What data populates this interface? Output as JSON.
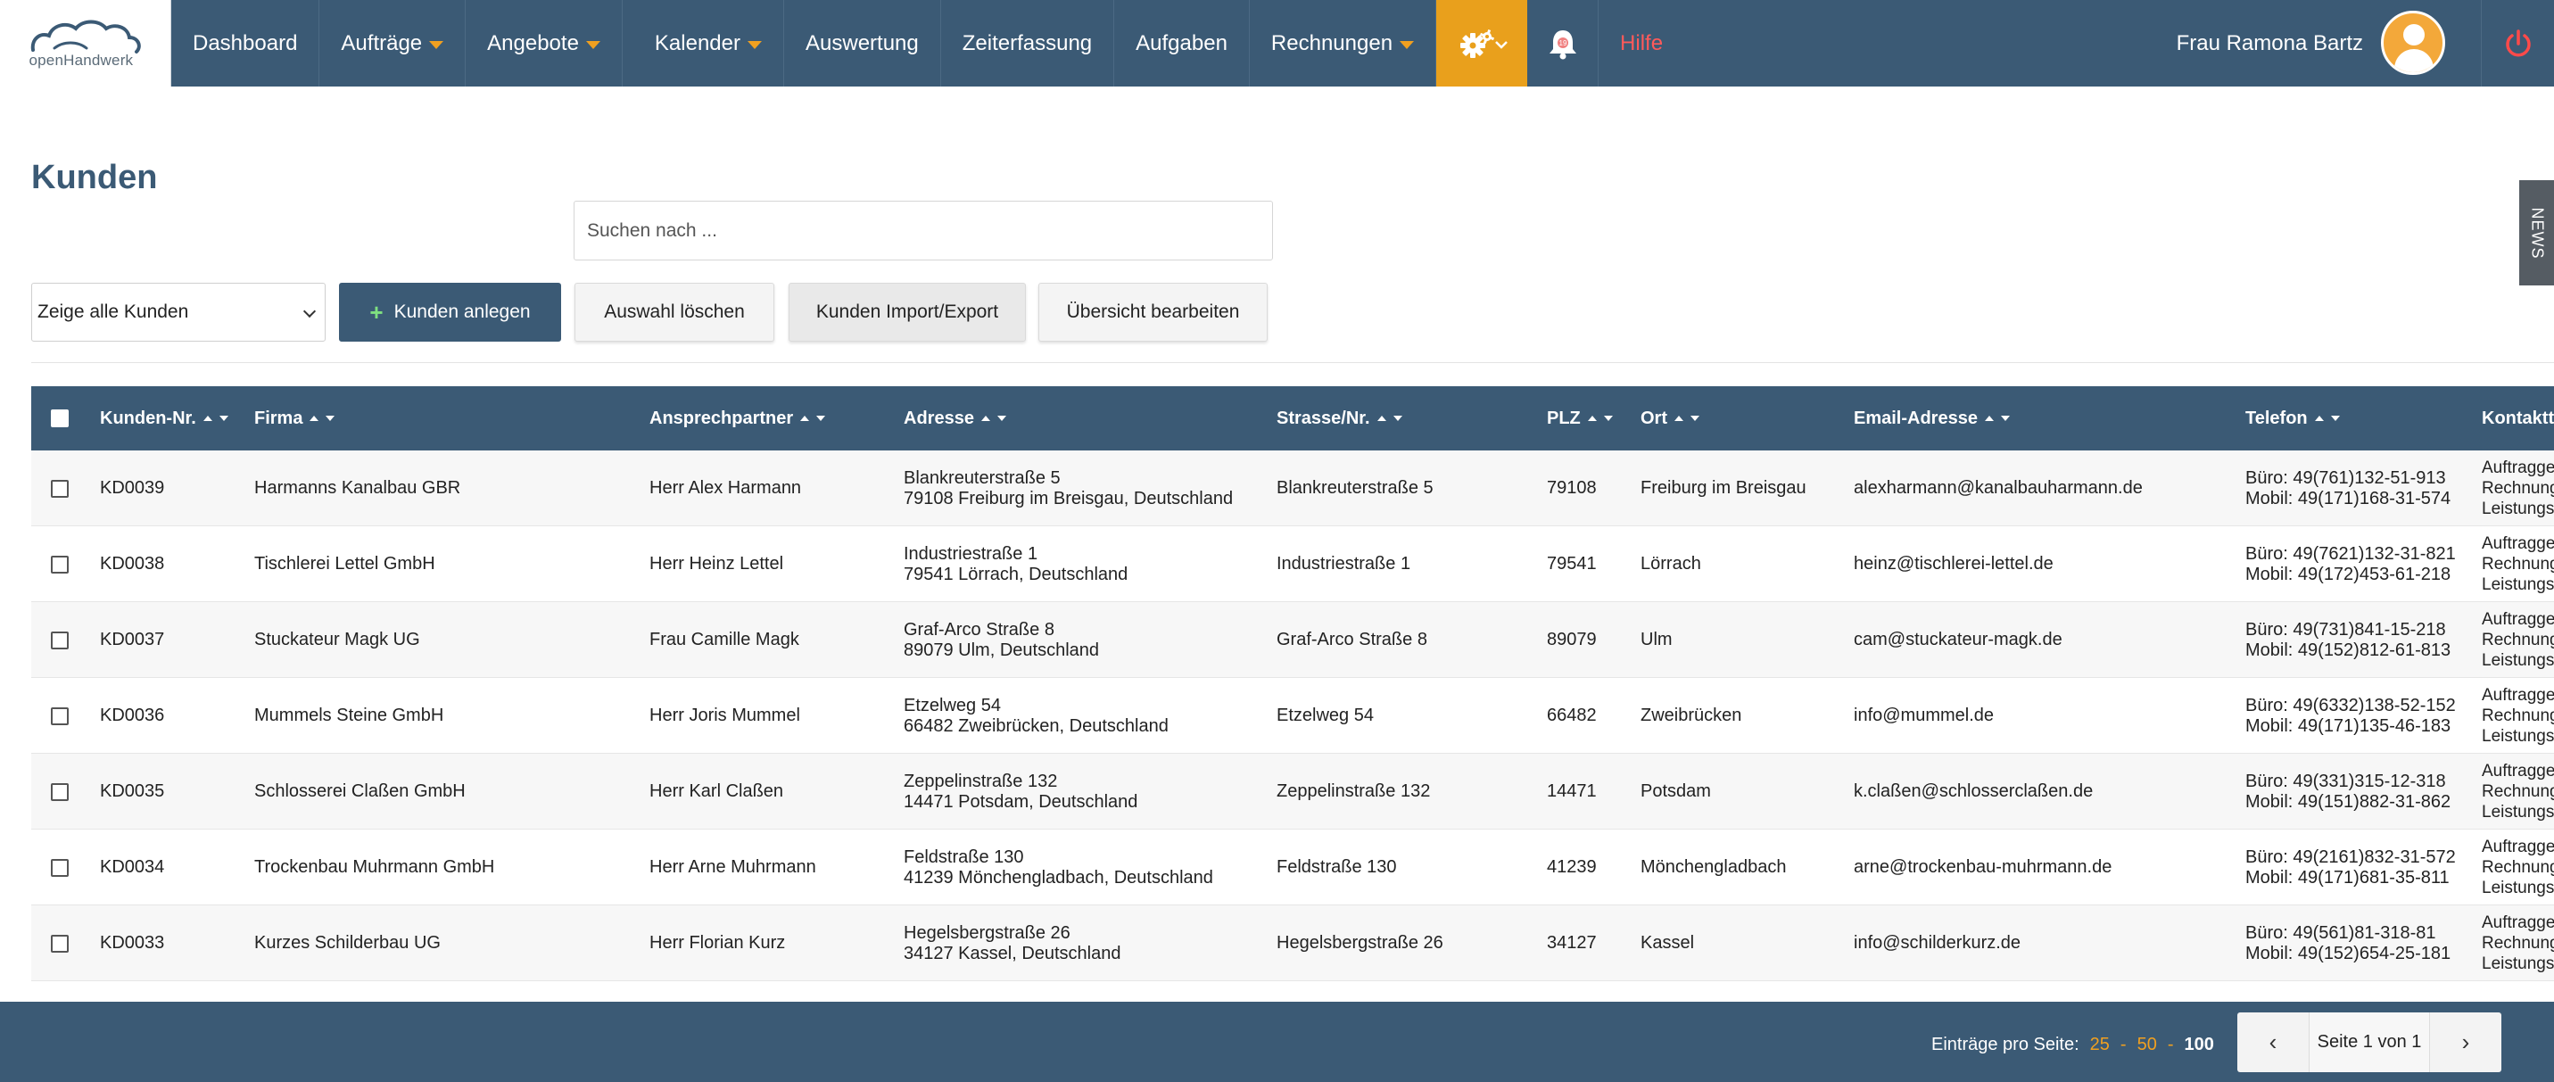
{
  "nav": {
    "logo_text": "openHandwerk",
    "items": [
      {
        "label": "Dashboard",
        "caret": false
      },
      {
        "label": "Aufträge",
        "caret": true
      },
      {
        "label": "Angebote",
        "caret": true
      },
      {
        "label": "Kalender",
        "caret": true
      },
      {
        "label": "Auswertung",
        "caret": false
      },
      {
        "label": "Zeiterfassung",
        "caret": false
      },
      {
        "label": "Aufgaben",
        "caret": false
      },
      {
        "label": "Rechnungen",
        "caret": true
      }
    ],
    "bell_count": "19",
    "help_label": "Hilfe",
    "user_name": "Frau Ramona Bartz",
    "accent_color": "#e9a01c",
    "nav_color": "#3b5a75"
  },
  "page": {
    "title": "Kunden",
    "search_placeholder": "Suchen nach ...",
    "filter_value": "Zeige alle Kunden",
    "btn_add": "Kunden anlegen",
    "btn_clear": "Auswahl löschen",
    "btn_import": "Kunden Import/Export",
    "btn_edit": "Übersicht bearbeiten",
    "news_tab": "NEWS"
  },
  "table": {
    "headers": {
      "nr": "Kunden-Nr.",
      "firma": "Firma",
      "ansprech": "Ansprechpartner",
      "adresse": "Adresse",
      "strasse": "Strasse/Nr.",
      "plz": "PLZ",
      "ort": "Ort",
      "email": "Email-Adresse",
      "telefon": "Telefon",
      "kontakt": "Kontaktt"
    },
    "rows": [
      {
        "nr": "KD0039",
        "firma": "Harmanns Kanalbau GBR",
        "ansprech": "Herr Alex Harmann",
        "adr1": "Blankreuterstraße 5",
        "adr2": "79108 Freiburg im Breisgau, Deutschland",
        "strasse": "Blankreuterstraße 5",
        "plz": "79108",
        "ort": "Freiburg im Breisgau",
        "email": "alexharmann@kanalbauharmann.de",
        "tel1": "Büro: 49(761)132-51-913",
        "tel2": "Mobil: 49(171)168-31-574",
        "k1": "Auftragge",
        "k2": "Rechnung",
        "k3": "Leistungs"
      },
      {
        "nr": "KD0038",
        "firma": "Tischlerei Lettel GmbH",
        "ansprech": "Herr Heinz Lettel",
        "adr1": "Industriestraße 1",
        "adr2": "79541 Lörrach, Deutschland",
        "strasse": "Industriestraße 1",
        "plz": "79541",
        "ort": "Lörrach",
        "email": "heinz@tischlerei-lettel.de",
        "tel1": "Büro: 49(7621)132-31-821",
        "tel2": "Mobil: 49(172)453-61-218",
        "k1": "Auftragge",
        "k2": "Rechnung",
        "k3": "Leistungs"
      },
      {
        "nr": "KD0037",
        "firma": "Stuckateur Magk UG",
        "ansprech": "Frau Camille Magk",
        "adr1": "Graf-Arco Straße 8",
        "adr2": "89079 Ulm, Deutschland",
        "strasse": "Graf-Arco Straße 8",
        "plz": "89079",
        "ort": "Ulm",
        "email": "cam@stuckateur-magk.de",
        "tel1": "Büro: 49(731)841-15-218",
        "tel2": "Mobil: 49(152)812-61-813",
        "k1": "Auftragge",
        "k2": "Rechnung",
        "k3": "Leistungs"
      },
      {
        "nr": "KD0036",
        "firma": "Mummels Steine GmbH",
        "ansprech": "Herr Joris Mummel",
        "adr1": "Etzelweg 54",
        "adr2": "66482 Zweibrücken, Deutschland",
        "strasse": "Etzelweg 54",
        "plz": "66482",
        "ort": "Zweibrücken",
        "email": "info@mummel.de",
        "tel1": "Büro: 49(6332)138-52-152",
        "tel2": "Mobil: 49(171)135-46-183",
        "k1": "Auftragge",
        "k2": "Rechnung",
        "k3": "Leistungs"
      },
      {
        "nr": "KD0035",
        "firma": "Schlosserei Claßen GmbH",
        "ansprech": "Herr Karl Claßen",
        "adr1": "Zeppelinstraße 132",
        "adr2": "14471 Potsdam, Deutschland",
        "strasse": "Zeppelinstraße 132",
        "plz": "14471",
        "ort": "Potsdam",
        "email": "k.claßen@schlosserclaßen.de",
        "tel1": "Büro: 49(331)315-12-318",
        "tel2": "Mobil: 49(151)882-31-862",
        "k1": "Auftragge",
        "k2": "Rechnung",
        "k3": "Leistungs"
      },
      {
        "nr": "KD0034",
        "firma": "Trockenbau Muhrmann GmbH",
        "ansprech": "Herr Arne Muhrmann",
        "adr1": "Feldstraße 130",
        "adr2": "41239 Mönchengladbach, Deutschland",
        "strasse": "Feldstraße 130",
        "plz": "41239",
        "ort": "Mönchengladbach",
        "email": "arne@trockenbau-muhrmann.de",
        "tel1": "Büro: 49(2161)832-31-572",
        "tel2": "Mobil: 49(171)681-35-811",
        "k1": "Auftragge",
        "k2": "Rechnung",
        "k3": "Leistungs"
      },
      {
        "nr": "KD0033",
        "firma": "Kurzes Schilderbau UG",
        "ansprech": "Herr Florian Kurz",
        "adr1": "Hegelsbergstraße 26",
        "adr2": "34127 Kassel, Deutschland",
        "strasse": "Hegelsbergstraße 26",
        "plz": "34127",
        "ort": "Kassel",
        "email": "info@schilderkurz.de",
        "tel1": "Büro: 49(561)81-318-81",
        "tel2": "Mobil: 49(152)654-25-181",
        "k1": "Auftragge",
        "k2": "Rechnung",
        "k3": "Leistungs"
      }
    ]
  },
  "footer": {
    "per_page_label": "Einträge pro Seite:",
    "options": [
      "25",
      "50",
      "100"
    ],
    "active_option": "100",
    "page_label": "Seite 1 von 1"
  }
}
